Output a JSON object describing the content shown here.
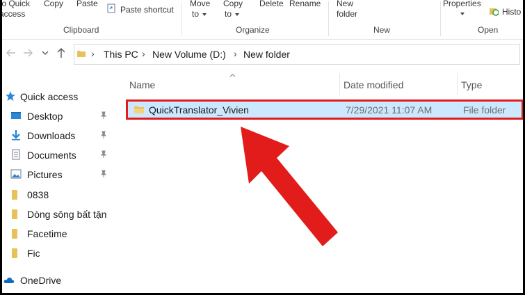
{
  "ribbon": {
    "clipboard": {
      "pin_line1": "to Quick",
      "pin_line2": "access",
      "copy": "Copy",
      "paste": "Paste",
      "paste_shortcut": "Paste shortcut",
      "group": "Clipboard"
    },
    "organize": {
      "move_line1": "Move",
      "move_line2": "to",
      "copy_line1": "Copy",
      "copy_line2": "to",
      "delete": "Delete",
      "rename": "Rename",
      "group": "Organize"
    },
    "new": {
      "line1": "New",
      "line2": "folder",
      "group": "New"
    },
    "open": {
      "properties": "Properties",
      "history": "Histo",
      "group": "Open"
    }
  },
  "address": {
    "crumbs": [
      "This PC",
      "New Volume (D:)",
      "New folder"
    ]
  },
  "nav": {
    "items": [
      {
        "label": "Quick access",
        "icon": "star-icon"
      },
      {
        "label": "Desktop",
        "icon": "desktop-icon",
        "pinned": true
      },
      {
        "label": "Downloads",
        "icon": "download-icon",
        "pinned": true
      },
      {
        "label": "Documents",
        "icon": "documents-icon",
        "pinned": true
      },
      {
        "label": "Pictures",
        "icon": "pictures-icon",
        "pinned": true
      },
      {
        "label": "0838",
        "icon": "folder-icon"
      },
      {
        "label": "Dòng sông bất tận",
        "icon": "folder-icon"
      },
      {
        "label": "Facetime",
        "icon": "folder-icon"
      },
      {
        "label": "Fic",
        "icon": "folder-icon"
      },
      {
        "label": "OneDrive",
        "icon": "cloud-icon"
      }
    ]
  },
  "columns": {
    "name": "Name",
    "date": "Date modified",
    "type": "Type"
  },
  "files": [
    {
      "name": "QuickTranslator_Vivien",
      "date": "7/29/2021 11:07 AM",
      "type": "File folder",
      "selected": true
    }
  ],
  "colors": {
    "selection": "#cce8ff",
    "highlight": "#e21b1b",
    "arrow": "#e21b1b",
    "folder": "#e8c15a"
  }
}
